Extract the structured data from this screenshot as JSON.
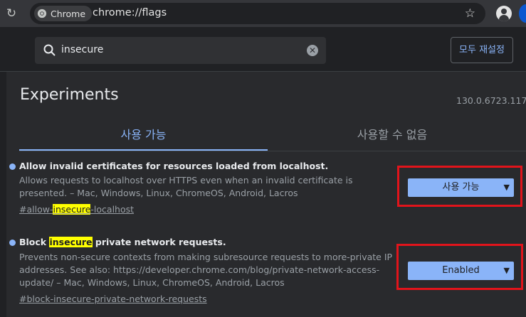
{
  "browser": {
    "chip_label": "Chrome",
    "url": "chrome://flags"
  },
  "flags_header": {
    "search_value": "insecure",
    "reset_label": "모두 재설정"
  },
  "page": {
    "title": "Experiments",
    "version": "130.0.6723.117"
  },
  "tabs": {
    "available": "사용 가능",
    "unavailable": "사용할 수 없음"
  },
  "experiments": [
    {
      "name": "Allow invalid certificates for resources loaded from localhost.",
      "description": "Allows requests to localhost over HTTPS even when an invalid certificate is presented. – Mac, Windows, Linux, ChromeOS, Android, Lacros",
      "link_prefix": "#allow-",
      "link_highlight": "insecure",
      "link_suffix": "-localhost",
      "selected": "사용 가능"
    },
    {
      "name_prefix": "Block ",
      "name_highlight": "insecure",
      "name_suffix": " private network requests.",
      "description": "Prevents non-secure contexts from making subresource requests to more-private IP addresses. See also: https://developer.chrome.com/blog/private-network-access-update/ – Mac, Windows, Linux, ChromeOS, Android, Lacros",
      "link": "#block-insecure-private-network-requests",
      "selected": "Enabled"
    }
  ],
  "colors": {
    "accent": "#8ab4f8",
    "highlight": "#ffff00",
    "annotation_box": "#e1141b"
  }
}
